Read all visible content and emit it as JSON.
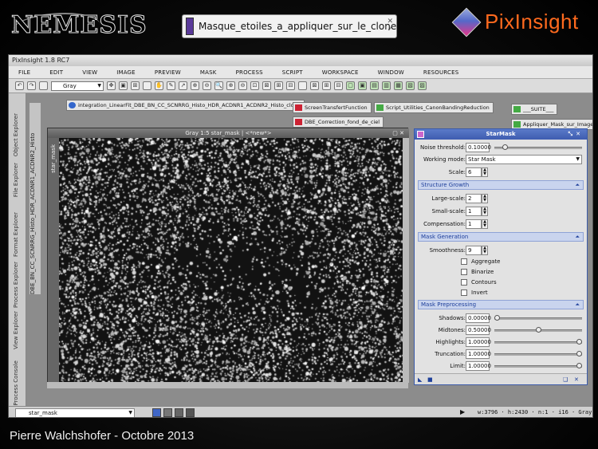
{
  "slide": {
    "brand_left": "NEMESIS",
    "brand_right": "PixInsight",
    "footer": "Pierre Walchshofer - Octobre 2013",
    "banner_label": "Masque_etoiles_a_appliquer_sur_le_clone"
  },
  "app": {
    "title": "PixInsight 1.8 RC7",
    "menu": [
      "FILE",
      "EDIT",
      "VIEW",
      "IMAGE",
      "PREVIEW",
      "MASK",
      "PROCESS",
      "SCRIPT",
      "WORKSPACE",
      "WINDOW",
      "RESOURCES"
    ],
    "color_mode": "Gray",
    "left_rail": [
      "Process Console",
      "View Explorer",
      "Process Explorer",
      "Format Explorer",
      "File Explorer",
      "Object Explorer"
    ],
    "vertical_view_label": "DBE_BN_CC_SCNRRG_Histo_HDR_ACDNR1_ACDNR2_Histo",
    "desktop_icons": [
      {
        "label": "integration_LinearFit_DBE_BN_CC_SCNRRG_Histo_HDR_ACDNR1_ACDNR2_Histo_clone",
        "kind": "b"
      },
      {
        "label": "ScreenTransfertFunction",
        "kind": "r"
      },
      {
        "label": "Script_Utilities_CanonBandingReduction",
        "kind": "g"
      },
      {
        "label": "___SUITE___",
        "kind": "g"
      },
      {
        "label": "Appliquer_Mask_sur_Image",
        "kind": "g"
      },
      {
        "label": "DBE_Correction_fond_de_ciel",
        "kind": "r"
      }
    ],
    "image_window": {
      "title": "Gray 1:5 star_mask | <*new*>",
      "side_label": "star_mask"
    },
    "status": {
      "view": "star_mask",
      "dims": "w:3796 · h:2430 · n:1 · i16 · Gray"
    }
  },
  "starmask": {
    "title": "StarMask",
    "noise_threshold_label": "Noise threshold:",
    "noise_threshold": "0.10000",
    "noise_threshold_level": 0.1,
    "working_mode_label": "Working mode:",
    "working_mode": "Star Mask",
    "scale_label": "Scale:",
    "scale": "6",
    "sections": {
      "structure_growth": "Structure Growth",
      "mask_generation": "Mask Generation",
      "mask_preprocessing": "Mask Preprocessing"
    },
    "large_scale_label": "Large-scale:",
    "large_scale": "2",
    "small_scale_label": "Small-scale:",
    "small_scale": "1",
    "compensation_label": "Compensation:",
    "compensation": "1",
    "smoothness_label": "Smoothness:",
    "smoothness": "9",
    "checkboxes": [
      "Aggregate",
      "Binarize",
      "Contours",
      "Invert"
    ],
    "shadows_label": "Shadows:",
    "shadows": "0.00000",
    "shadows_level": 0.0,
    "midtones_label": "Midtones:",
    "midtones": "0.50000",
    "midtones_level": 0.5,
    "highlights_label": "Highlights:",
    "highlights": "1.00000",
    "highlights_level": 1.0,
    "truncation_label": "Truncation:",
    "truncation": "1.00000",
    "truncation_level": 1.0,
    "limit_label": "Limit:",
    "limit": "1.00000",
    "limit_level": 1.0
  }
}
